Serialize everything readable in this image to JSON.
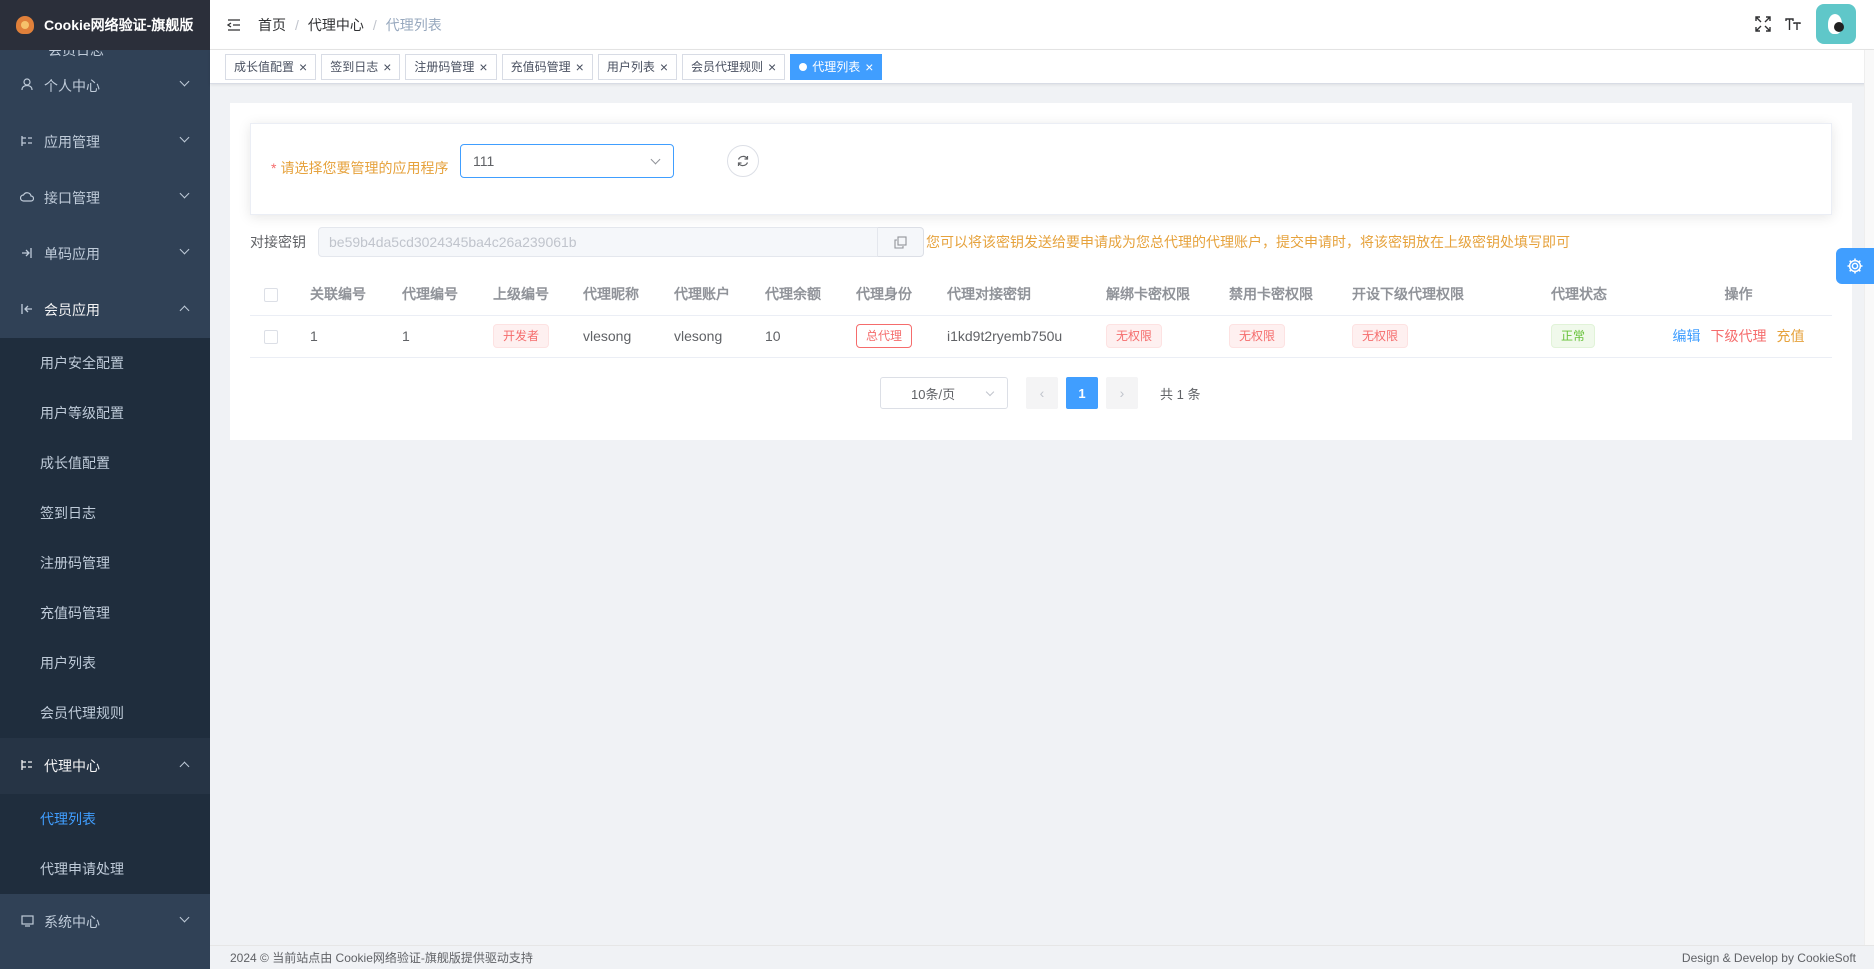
{
  "app": {
    "title": "Cookie网络验证-旗舰版"
  },
  "sidebar": {
    "cut_label": "会员日志",
    "items": [
      {
        "label": "个人中心",
        "icon": "user-icon",
        "open": false
      },
      {
        "label": "应用管理",
        "icon": "tree-icon",
        "open": false
      },
      {
        "label": "接口管理",
        "icon": "cloud-icon",
        "open": false
      },
      {
        "label": "单码应用",
        "icon": "login-icon",
        "open": false
      },
      {
        "label": "会员应用",
        "icon": "collapse-icon",
        "open": true,
        "children": [
          "用户安全配置",
          "用户等级配置",
          "成长值配置",
          "签到日志",
          "注册码管理",
          "充值码管理",
          "用户列表",
          "会员代理规则"
        ]
      },
      {
        "label": "代理中心",
        "icon": "tree-icon",
        "open": true,
        "children": [
          "代理列表",
          "代理申请处理"
        ],
        "active_child": "代理列表"
      },
      {
        "label": "系统中心",
        "icon": "monitor-icon",
        "open": false
      }
    ]
  },
  "breadcrumb": [
    "首页",
    "代理中心",
    "代理列表"
  ],
  "tags": [
    {
      "label": "成长值配置",
      "active": false
    },
    {
      "label": "签到日志",
      "active": false
    },
    {
      "label": "注册码管理",
      "active": false
    },
    {
      "label": "充值码管理",
      "active": false
    },
    {
      "label": "用户列表",
      "active": false
    },
    {
      "label": "会员代理规则",
      "active": false
    },
    {
      "label": "代理列表",
      "active": true
    }
  ],
  "form": {
    "required_mark": "*",
    "app_label": "请选择您要管理的应用程序",
    "app_value": "111"
  },
  "key": {
    "label": "对接密钥",
    "value": "be59b4da5cd3024345ba4c26a239061b",
    "hint": "您可以将该密钥发送给要申请成为您总代理的代理账户，提交申请时，将该密钥放在上级密钥处填写即可"
  },
  "table": {
    "headers": [
      "关联编号",
      "代理编号",
      "上级编号",
      "代理昵称",
      "代理账户",
      "代理余额",
      "代理身份",
      "代理对接密钥",
      "解绑卡密权限",
      "禁用卡密权限",
      "开设下级代理权限",
      "代理状态",
      "操作"
    ],
    "rows": [
      {
        "rel_id": "1",
        "agent_id": "1",
        "parent": "开发者",
        "nickname": "vlesong",
        "account": "vlesong",
        "balance": "10",
        "role": "总代理",
        "agent_key": "i1kd9t2ryemb750u",
        "unbind_perm": "无权限",
        "disable_perm": "无权限",
        "sub_perm": "无权限",
        "status": "正常",
        "actions": [
          "编辑",
          "下级代理",
          "充值"
        ]
      }
    ]
  },
  "pagination": {
    "page_size": "10条/页",
    "current": "1",
    "prev": "‹",
    "next": "›",
    "total": "共 1 条"
  },
  "footer": {
    "left": "2024 © 当前站点由 Cookie网络验证-旗舰版提供驱动支持",
    "right": "Design & Develop by CookieSoft"
  }
}
